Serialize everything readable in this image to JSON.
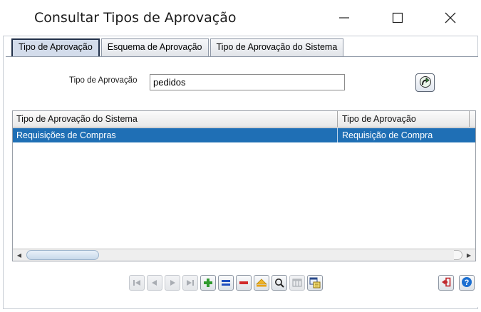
{
  "window": {
    "title": "Consultar Tipos de Aprovação",
    "controls": [
      "minimize-icon",
      "maximize-icon",
      "close-icon"
    ]
  },
  "tabs": [
    {
      "label": "Tipo de Aprovação",
      "active": true
    },
    {
      "label": "Esquema de Aprovação",
      "active": false
    },
    {
      "label": "Tipo de Aprovação do Sistema",
      "active": false
    }
  ],
  "search": {
    "label": "Tipo de Aprovação",
    "value": "pedidos",
    "go_icon": "arrow-forward-icon"
  },
  "grid": {
    "columns": [
      "Tipo de Aprovação do Sistema",
      "Tipo de Aprovação"
    ],
    "rows": [
      [
        "Requisições de Compras",
        "Requisição  de Compra"
      ]
    ],
    "selected_row": 0
  },
  "toolbar": {
    "buttons": [
      {
        "icon": "first-record-icon",
        "enabled": false
      },
      {
        "icon": "previous-record-icon",
        "enabled": false
      },
      {
        "icon": "next-record-icon",
        "enabled": false
      },
      {
        "icon": "last-record-icon",
        "enabled": false
      },
      {
        "icon": "add-icon",
        "enabled": true
      },
      {
        "icon": "equals-icon",
        "enabled": true
      },
      {
        "icon": "remove-icon",
        "enabled": true
      },
      {
        "icon": "clear-icon",
        "enabled": true
      },
      {
        "icon": "search-icon",
        "enabled": true
      },
      {
        "icon": "columns-icon",
        "enabled": false
      },
      {
        "icon": "export-icon",
        "enabled": true
      }
    ],
    "right_buttons": [
      "exit-icon",
      "help-icon"
    ]
  },
  "colors": {
    "selection": "#1f6fb5",
    "add": "#2e9a2e",
    "remove": "#d12b2b",
    "equals": "#1f4fbf",
    "help": "#1c6fd1",
    "exit": "#c0262b"
  }
}
